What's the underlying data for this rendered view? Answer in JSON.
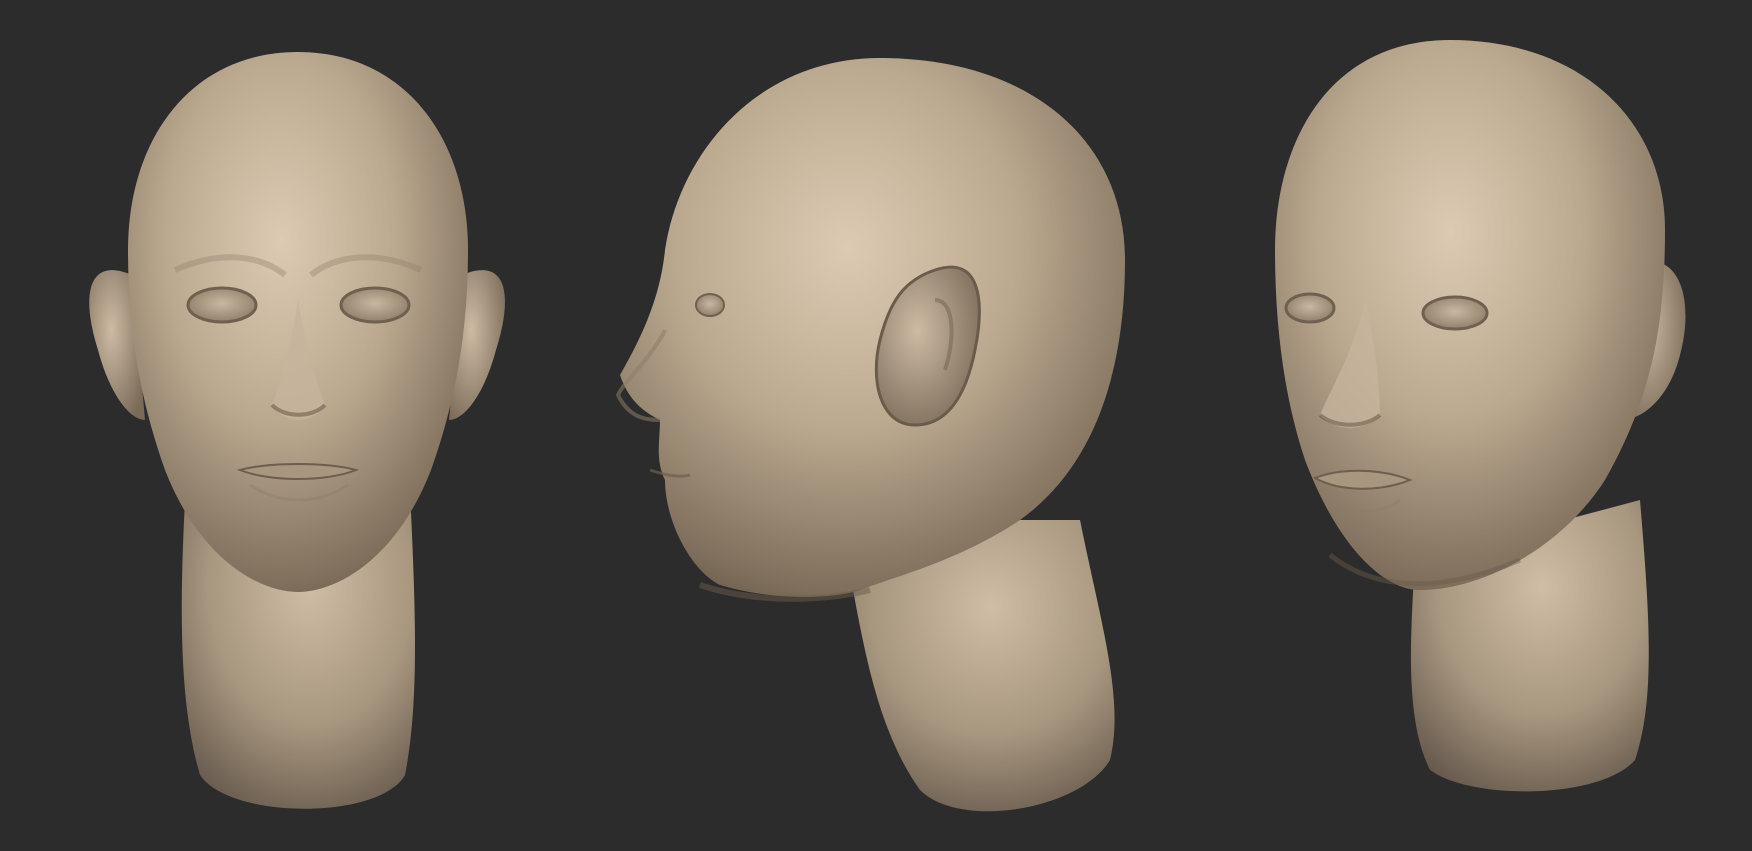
{
  "scene": {
    "background_color": "#2c2c2d",
    "material_color": "#c3b3a0",
    "views": [
      {
        "name": "front-view"
      },
      {
        "name": "side-view"
      },
      {
        "name": "three-quarter-view"
      }
    ]
  }
}
